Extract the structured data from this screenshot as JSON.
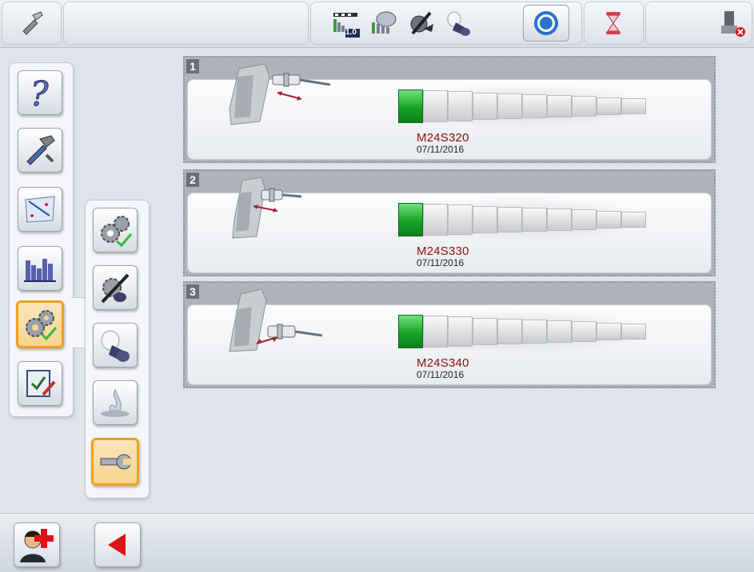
{
  "topbar": {
    "speed_label": "1.0",
    "icons": [
      "tool-icon",
      "speed-icon",
      "coolant-icon",
      "feed-icon",
      "part-icon",
      "record-icon",
      "hourglass-icon",
      "disconnect-icon"
    ]
  },
  "menu": {
    "main_items": [
      {
        "name": "help-icon",
        "active": false
      },
      {
        "name": "hammer-tool-icon",
        "active": false
      },
      {
        "name": "drawing-icon",
        "active": false
      },
      {
        "name": "histogram-icon",
        "active": false
      },
      {
        "name": "settings-gears-icon",
        "active": true
      },
      {
        "name": "checklist-icon",
        "active": false
      }
    ],
    "sub_items": [
      {
        "name": "gears-check-icon",
        "active": false
      },
      {
        "name": "tool-settings-icon",
        "active": false
      },
      {
        "name": "workpiece-icon",
        "active": false
      },
      {
        "name": "flame-icon",
        "active": false
      },
      {
        "name": "wrench-icon",
        "active": true
      }
    ]
  },
  "programs": [
    {
      "number": "1",
      "name": "M24S320",
      "date": "07/11/2016",
      "gauge_on": 1,
      "gauge_total": 10
    },
    {
      "number": "2",
      "name": "M24S330",
      "date": "07/11/2016",
      "gauge_on": 1,
      "gauge_total": 10
    },
    {
      "number": "3",
      "name": "M24S340",
      "date": "07/11/2016",
      "gauge_on": 1,
      "gauge_total": 10
    }
  ],
  "bottombar": {
    "icons": [
      "add-user-icon",
      "back-arrow-icon"
    ]
  },
  "colors": {
    "accent": "#f0a01e",
    "program_name": "#8b0f0f",
    "gauge_on": "#18a327",
    "back_arrow": "#e0101a"
  }
}
